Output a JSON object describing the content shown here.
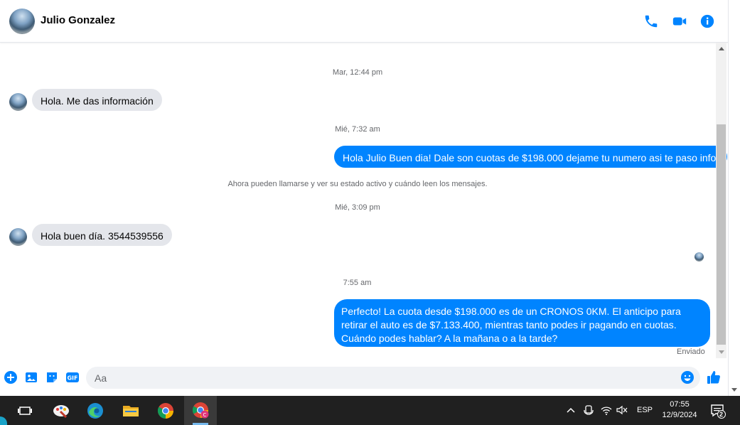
{
  "header": {
    "contact_name": "Julio Gonzalez",
    "icons": [
      "phone-icon",
      "video-camera-icon",
      "info-icon"
    ],
    "accent_color": "#0084ff"
  },
  "conversation": {
    "timestamps": [
      "Mar, 12:44 pm",
      "Mié, 7:32 am",
      "Mié, 3:09 pm",
      "7:55 am"
    ],
    "messages": [
      {
        "direction": "in",
        "text": "Hola. Me das información"
      },
      {
        "direction": "out",
        "text": "Hola  Julio Buen dia! Dale son cuotas de $198.000 dejame tu numero asi te paso info."
      },
      {
        "direction": "in",
        "text": "Hola buen día. 3544539556"
      },
      {
        "direction": "out",
        "text": "Perfecto! La cuota desde $198.000 es de un CRONOS 0KM. El anticipo para retirar el auto es de $7.133.400, mientras tanto podes ir pagando en cuotas. Cuándo podes hablar? A la mañana o a la tarde?"
      }
    ],
    "notice": "Ahora pueden llamarse y ver su estado activo y cuándo leen los mensajes.",
    "status": "Enviado"
  },
  "composer": {
    "placeholder": "Aa",
    "icons": [
      "plus-circle-icon",
      "photo-icon",
      "sticker-icon",
      "gif-icon",
      "emoji-icon",
      "thumbs-up-icon"
    ]
  },
  "taskbar": {
    "apps": [
      "task-view-icon",
      "paint-app-icon",
      "edge-browser-icon",
      "file-explorer-icon",
      "chrome-icon",
      "chrome-profile-icon"
    ],
    "language": "ESP",
    "time": "07:55",
    "date": "12/9/2024",
    "notification_count": "2"
  }
}
